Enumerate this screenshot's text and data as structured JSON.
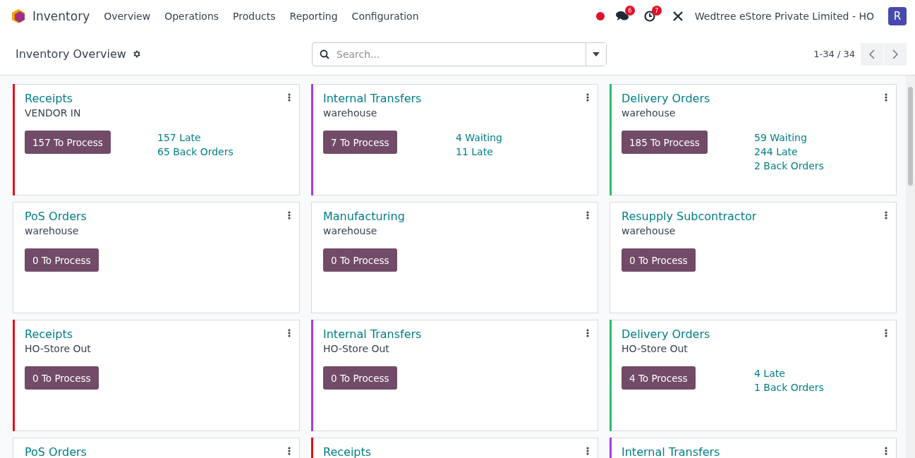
{
  "navbar": {
    "app_name": "Inventory",
    "menu": [
      "Overview",
      "Operations",
      "Products",
      "Reporting",
      "Configuration"
    ],
    "messages_count": "6",
    "activities_count": "7",
    "company": "Wedtree eStore Private Limited - HO",
    "avatar": "R"
  },
  "control_panel": {
    "title": "Inventory Overview",
    "search": {
      "placeholder": "Search..."
    },
    "pager": "1-34 / 34"
  },
  "cards": [
    {
      "title": "Receipts",
      "subtitle": "VENDOR IN",
      "button": "157 To Process",
      "stats": [
        "157 Late",
        "65 Back Orders"
      ],
      "color": "#e0101c"
    },
    {
      "title": "Internal Transfers",
      "subtitle": "warehouse",
      "button": "7 To Process",
      "stats": [
        "4 Waiting",
        "11 Late"
      ],
      "color": "#a23ee0"
    },
    {
      "title": "Delivery Orders",
      "subtitle": "warehouse",
      "button": "185 To Process",
      "stats": [
        "59 Waiting",
        "244 Late",
        "2 Back Orders"
      ],
      "color": "#2ebd6b"
    },
    {
      "title": "PoS Orders",
      "subtitle": "warehouse",
      "button": "0 To Process"
    },
    {
      "title": "Manufacturing",
      "subtitle": "warehouse",
      "button": "0 To Process"
    },
    {
      "title": "Resupply Subcontractor",
      "subtitle": "warehouse",
      "button": "0 To Process"
    },
    {
      "title": "Receipts",
      "subtitle": "HO-Store Out",
      "button": "0 To Process",
      "color": "#e0101c"
    },
    {
      "title": "Internal Transfers",
      "subtitle": "HO-Store Out",
      "button": "0 To Process",
      "color": "#a23ee0"
    },
    {
      "title": "Delivery Orders",
      "subtitle": "HO-Store Out",
      "button": "4 To Process",
      "stats": [
        "4 Late",
        "1 Back Orders"
      ],
      "color": "#2ebd6b"
    },
    {
      "title": "PoS Orders"
    },
    {
      "title": "Receipts",
      "color": "#e0101c"
    },
    {
      "title": "Internal Transfers",
      "color": "#a23ee0"
    }
  ]
}
